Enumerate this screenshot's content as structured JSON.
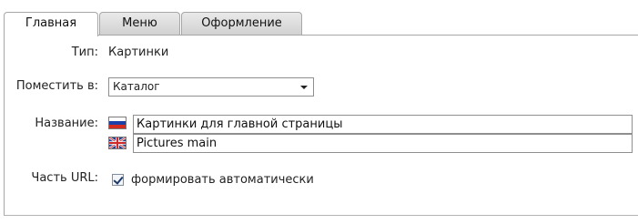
{
  "tabs": [
    {
      "label": "Главная",
      "active": true
    },
    {
      "label": "Меню",
      "active": false
    },
    {
      "label": "Оформление",
      "active": false
    }
  ],
  "form": {
    "type_label": "Тип:",
    "type_value": "Картинки",
    "place_label": "Поместить в:",
    "place_selected": "Каталог",
    "name_label": "Название:",
    "name_ru_value": "Картинки для главной страницы",
    "name_en_value": "Pictures main",
    "url_label": "Часть URL:",
    "url_checkbox_label": "формировать автоматически",
    "url_checkbox_checked": true
  },
  "icons": {
    "flag_ru": "russia-flag-icon",
    "flag_en": "uk-flag-icon",
    "dropdown": "chevron-down-icon"
  }
}
